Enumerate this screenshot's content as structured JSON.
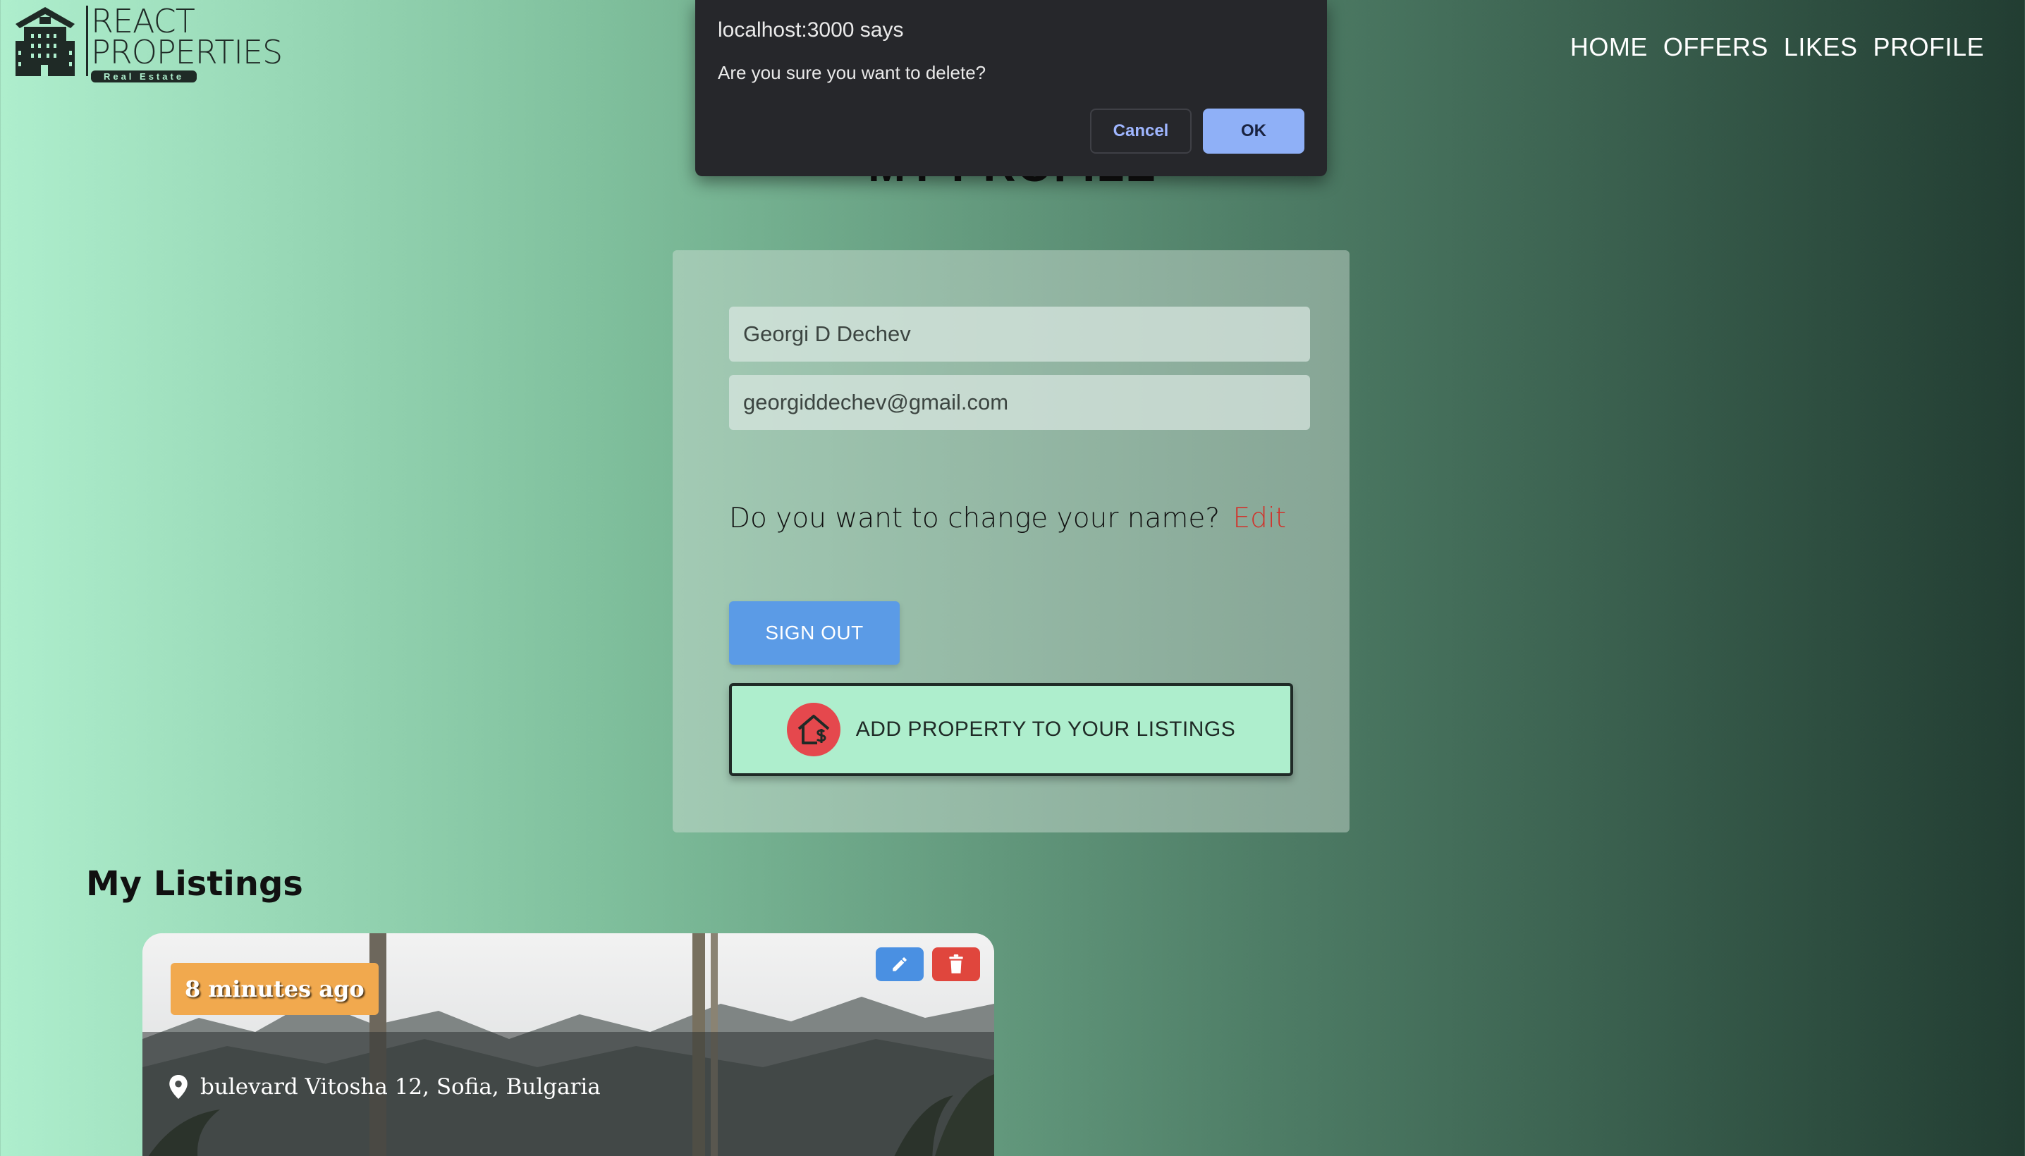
{
  "header": {
    "logo": {
      "line1": "REACT",
      "line2": "PROPERTIES",
      "line3": "Real Estate"
    },
    "nav": {
      "home": "HOME",
      "offers": "OFFERS",
      "likes": "LIKES",
      "profile": "PROFILE"
    }
  },
  "page": {
    "title": "MY PROFILE"
  },
  "profile": {
    "name_value": "Georgi D Dechev",
    "email_value": "georgiddechev@gmail.com",
    "change_name_prompt": "Do you want to change your name?",
    "edit_label": "Edit",
    "sign_out_label": "SIGN OUT",
    "add_property_label": "ADD PROPERTY TO YOUR LISTINGS"
  },
  "listings": {
    "title": "My Listings",
    "items": [
      {
        "time_ago": "8 minutes ago",
        "address": "bulevard Vitosha 12, Sofia, Bulgaria"
      }
    ]
  },
  "dialog": {
    "title": "localhost:3000 says",
    "message": "Are you sure you want to delete?",
    "cancel_label": "Cancel",
    "ok_label": "OK"
  },
  "colors": {
    "accent_mint": "#aeeecd",
    "sign_out_blue": "#5b9be6",
    "edit_red": "#d0332c",
    "time_badge_orange": "#f1a94e",
    "delete_red": "#e0463d",
    "dialog_bg": "#26272b",
    "dialog_ok": "#8fb0f7"
  },
  "icons": {
    "logo": "building-icon",
    "add_property": "house-dollar-icon",
    "edit": "pencil-icon",
    "delete": "trash-icon",
    "address": "location-pin-icon"
  }
}
